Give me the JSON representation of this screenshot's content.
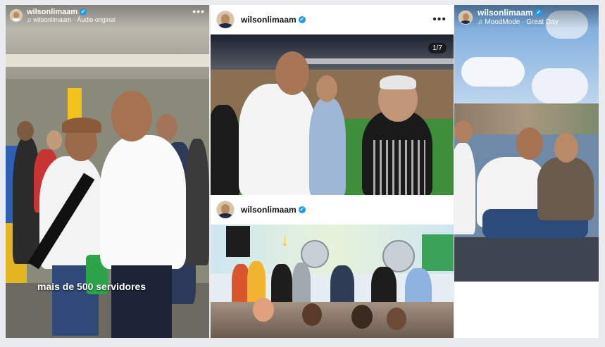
{
  "post_left": {
    "username": "wilsonlimaam",
    "audio": "wilsonlimaam · Áudio original",
    "caption": "mais de 500 servidores",
    "menu_icon": "more-horizontal-icon"
  },
  "post_center_top": {
    "username": "wilsonlimaam",
    "page_counter": "1/7",
    "menu_icon": "more-horizontal-icon"
  },
  "post_center_bottom": {
    "username": "wilsonlimaam"
  },
  "post_right": {
    "username": "wilsonlimaam",
    "audio": "MoodMode · Great Day"
  },
  "colors": {
    "verified": "#1d9bf0",
    "background": "#e9ebef"
  }
}
